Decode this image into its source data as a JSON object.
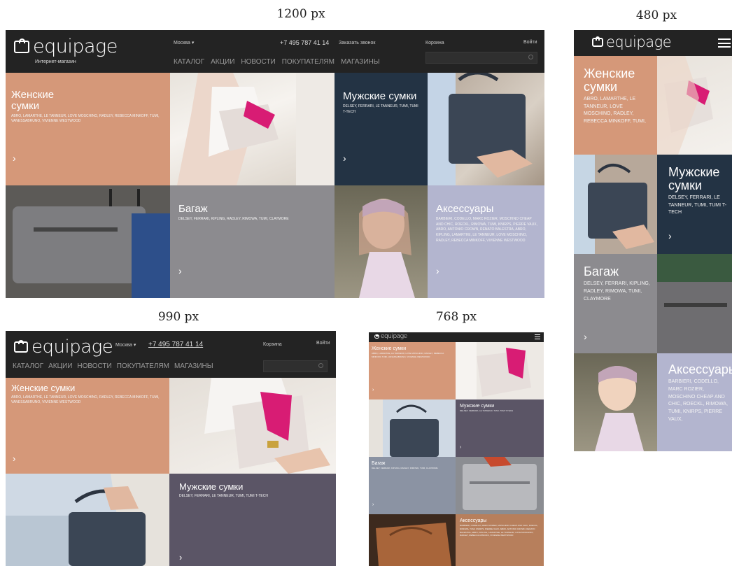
{
  "captions": {
    "w1200": "1200 px",
    "w480": "480 px",
    "w990": "990 px",
    "w768": "768 px"
  },
  "header": {
    "logo_text": "equipage",
    "logo_sub": "Интернет-магазин",
    "city": "Москва",
    "phone": "+7 495 787 41 14",
    "callback": "Заказать звонок",
    "cart": "Корзина",
    "login": "Войти",
    "nav": [
      "КАТАЛОГ",
      "АКЦИИ",
      "НОВОСТИ",
      "ПОКУПАТЕЛЯМ",
      "МАГАЗИНЫ"
    ]
  },
  "categories": {
    "women": {
      "title": "Женские сумки",
      "brands_full": "ABRO, LAMARTHE, LE TANNEUR, LOVE MOSCHINO, RADLEY, REBECCA MINKOFF, TUMI, VANESSABRUNO, VIVIENNE WESTWOOD",
      "brands_mobile": "ABRO, LAMARTHE, LE TANNEUR, LOVE MOSCHINO, RADLEY, REBECCA MINKOFF, TUMI,"
    },
    "men": {
      "title": "Мужские сумки",
      "brands_full": "DELSEY, FERRARI, LE TANNEUR, TUMI, TUMI T-TECH"
    },
    "luggage": {
      "title": "Багаж",
      "brands_full": "DELSEY, FERRARI, KIPLING, RADLEY, RIMOWA, TUMI, CLAYMORE"
    },
    "accessories": {
      "title": "Аксессуары",
      "brands_full": "BARBIERI, CODELLO, MARC ROZIER, MOSCHINO CHEAP AND CHIC, ROECKL, RIMOWA, TUMI, KNIRPS, PIERRE VAUX, ABRO, ANTONIO CROWN, RENATO BALESTRA, ABRO, KIPLING, LAMARTHE, LE TANNEUR, LOVE MOSCHINO, RADLEY, REBECCA MINKOFF, VIVIENNE WESTWOOD",
      "brands_mobile": "BARBIERI, CODELLO, MARC ROZIER, MOSCHINO CHEAP AND CHIC, ROECKL, RIMOWA, TUMI, KNIRPS, PIERRE VAUX,"
    }
  },
  "arrow": "›",
  "colors": {
    "header": "#232323",
    "women": "#d59879",
    "men": "#233344",
    "luggage": "#8c8b8f",
    "accessories": "#b3b5cf",
    "men_990": "#5b5566"
  }
}
